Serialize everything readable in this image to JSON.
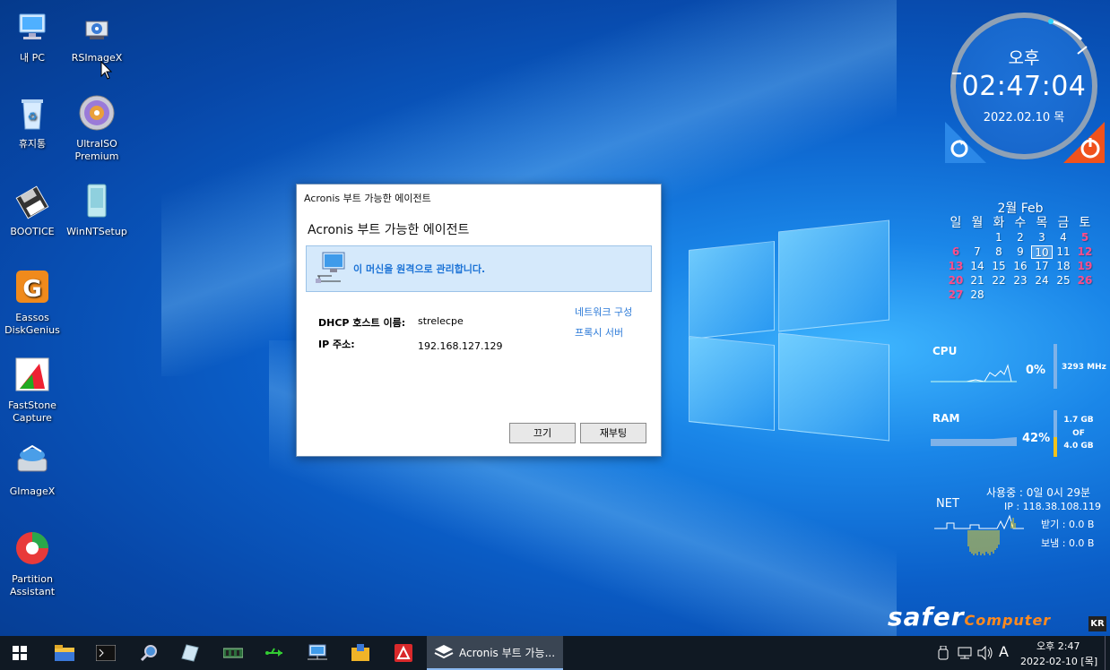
{
  "desktop": {
    "icons": [
      {
        "label": "내 PC"
      },
      {
        "label": "RSImageX"
      },
      {
        "label": "휴지통"
      },
      {
        "label": "UltraISO Premium"
      },
      {
        "label": "BOOTICE"
      },
      {
        "label": "WinNTSetup"
      },
      {
        "label": "Eassos DiskGenius"
      },
      {
        "label": "FastStone Capture"
      },
      {
        "label": "GImageX"
      },
      {
        "label": "Partition Assistant"
      }
    ]
  },
  "dialog": {
    "window_title": "Acronis 부트 가능한 에이전트",
    "heading": "Acronis 부트 가능한 에이전트",
    "banner_text": "이 머신을 원격으로 관리합니다.",
    "dhcp_label": "DHCP 호스트 이름:",
    "dhcp_value": "strelecpe",
    "ip_label": "IP 주소:",
    "ip_value": "192.168.127.129",
    "link_network": "네트워크 구성",
    "link_proxy": "프록시 서버",
    "button_close": "끄기",
    "button_reboot": "재부팅"
  },
  "clock": {
    "ampm": "오후",
    "time": "02:47:04",
    "date": "2022.02.10 목"
  },
  "calendar": {
    "title": "2월 Feb",
    "weekdays": [
      "일",
      "월",
      "화",
      "수",
      "목",
      "금",
      "토"
    ],
    "today": "10",
    "weeks": [
      [
        "",
        "",
        "1",
        "2",
        "3",
        "4",
        "5"
      ],
      [
        "6",
        "7",
        "8",
        "9",
        "10",
        "11",
        "12"
      ],
      [
        "13",
        "14",
        "15",
        "16",
        "17",
        "18",
        "19"
      ],
      [
        "20",
        "21",
        "22",
        "23",
        "24",
        "25",
        "26"
      ],
      [
        "27",
        "28",
        "",
        "",
        "",
        "",
        ""
      ]
    ]
  },
  "meters": {
    "cpu": {
      "label": "CPU",
      "value": "0%",
      "freq": "3293 MHz"
    },
    "ram": {
      "label": "RAM",
      "value": "42%",
      "used": "1.7 GB",
      "of": "OF",
      "total": "4.0 GB"
    },
    "net": {
      "label": "NET",
      "uptime": "사용중 : 0일 0시 29분",
      "ip": "IP : 118.38.108.119",
      "recv": "받기 : 0.0 B",
      "send": "보냄 : 0.0 B"
    }
  },
  "branding": {
    "brand": "safer",
    "brand_suffix": "Computer",
    "ime": "KR"
  },
  "taskbar": {
    "active_window": "Acronis 부트 가능...",
    "tray_lang": "A",
    "clock_time": "오후 2:47",
    "clock_date": "2022-02-10 [목]"
  },
  "colors": {
    "accent_blue": "#1c73d6",
    "weekend_pink": "#ff4d8a",
    "brand_orange": "#ff8a1f",
    "taskbar_bg": "#101923"
  }
}
